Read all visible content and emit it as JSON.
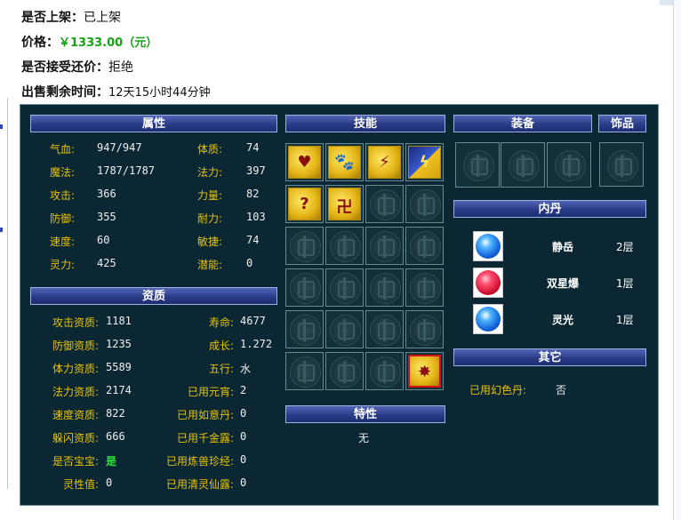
{
  "listing": {
    "shelved": {
      "label": "是否上架：",
      "value": "已上架"
    },
    "price": {
      "label": "价格：",
      "value": "￥1333.00（元）"
    },
    "bargain": {
      "label": "是否接受还价：",
      "value": "拒绝"
    },
    "remaining": {
      "label": "出售剩余时间：",
      "value": "12天15小时44分钟"
    }
  },
  "headers": {
    "attributes": "属性",
    "skills": "技能",
    "equipment": "装备",
    "ornament": "饰品",
    "aptitude": "资质",
    "neidan": "内丹",
    "traits": "特性",
    "other": "其它"
  },
  "attributes": [
    {
      "label": "气血:",
      "value": "947/947",
      "label2": "体质:",
      "value2": "74"
    },
    {
      "label": "魔法:",
      "value": "1787/1787",
      "label2": "法力:",
      "value2": "397"
    },
    {
      "label": "攻击:",
      "value": "366",
      "label2": "力量:",
      "value2": "82"
    },
    {
      "label": "防御:",
      "value": "355",
      "label2": "耐力:",
      "value2": "103"
    },
    {
      "label": "速度:",
      "value": "60",
      "label2": "敏捷:",
      "value2": "74"
    },
    {
      "label": "灵力:",
      "value": "425",
      "label2": "潜能:",
      "value2": "0"
    }
  ],
  "aptitude": [
    {
      "label": "攻击资质:",
      "value": "1181",
      "label2": "寿命:",
      "value2": "4677"
    },
    {
      "label": "防御资质:",
      "value": "1235",
      "label2": "成长:",
      "value2": "1.272"
    },
    {
      "label": "体力资质:",
      "value": "5589",
      "label2": "五行:",
      "value2": "水"
    },
    {
      "label": "法力资质:",
      "value": "2174",
      "label2": "已用元宵:",
      "value2": "2"
    },
    {
      "label": "速度资质:",
      "value": "822",
      "label2": "已用如意丹:",
      "value2": "0"
    },
    {
      "label": "躲闪资质:",
      "value": "666",
      "label2": "已用千金露:",
      "value2": "0"
    },
    {
      "label": "是否宝宝:",
      "value": "是",
      "label2": "已用炼兽珍经:",
      "value2": "0"
    },
    {
      "label": "灵性值:",
      "value": "0",
      "label2": "已用清灵仙露:",
      "value2": "0"
    }
  ],
  "skills": [
    {
      "icon": "heart-skill-icon",
      "glyph": "♥"
    },
    {
      "icon": "beast-skill-icon",
      "glyph": "🐾"
    },
    {
      "icon": "claw-skill-icon",
      "glyph": "⚡"
    },
    {
      "icon": "lightning-skill-icon",
      "glyph": "ϟ"
    },
    {
      "icon": "mystery-skill-icon",
      "glyph": "?"
    },
    {
      "icon": "rune-skill-icon",
      "glyph": "卍"
    }
  ],
  "special_skill": {
    "icon": "meteor-skill-icon",
    "glyph": "✸"
  },
  "neidan": [
    {
      "name": "静岳",
      "level": "2层",
      "color": "#1060d8"
    },
    {
      "name": "双星爆",
      "level": "1层",
      "color": "#d01030"
    },
    {
      "name": "灵光",
      "level": "1层",
      "color": "#1060d8"
    }
  ],
  "traits": {
    "value": "无"
  },
  "other": {
    "label": "已用幻色丹:",
    "value": "否"
  }
}
